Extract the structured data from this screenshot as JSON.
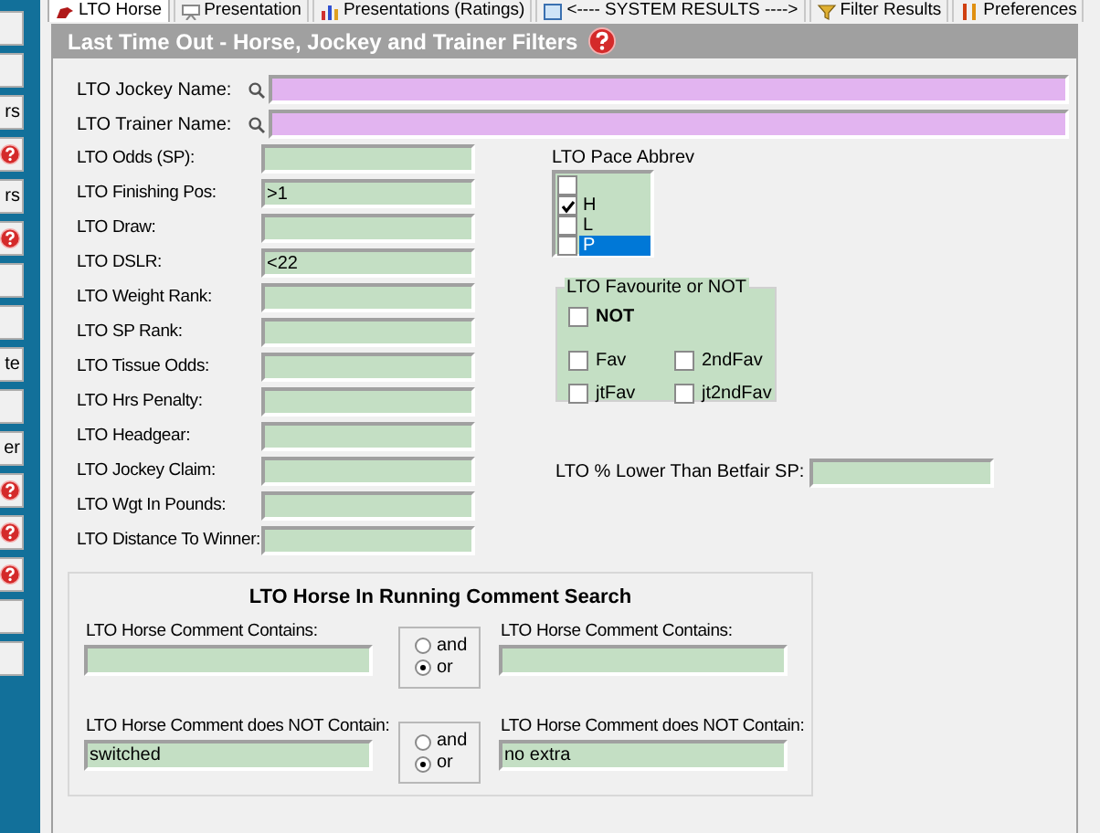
{
  "sidebar": {
    "items": [
      {
        "kind": "button"
      },
      {
        "kind": "button"
      },
      {
        "kind": "button",
        "label": "rs"
      },
      {
        "kind": "help"
      },
      {
        "kind": "button",
        "label": "rs"
      },
      {
        "kind": "help"
      },
      {
        "kind": "button"
      },
      {
        "kind": "button"
      },
      {
        "kind": "button",
        "label": "te"
      },
      {
        "kind": "button"
      },
      {
        "kind": "button",
        "label": "er"
      },
      {
        "kind": "help"
      },
      {
        "kind": "help"
      },
      {
        "kind": "help"
      },
      {
        "kind": "button"
      },
      {
        "kind": "button"
      }
    ]
  },
  "tabs": [
    {
      "label": "LTO Horse",
      "selected": true
    },
    {
      "label": "Presentation",
      "selected": false
    },
    {
      "label": "Presentations (Ratings)",
      "selected": false
    },
    {
      "label": "<---- SYSTEM RESULTS ---->",
      "selected": false
    },
    {
      "label": "Filter Results",
      "selected": false
    },
    {
      "label": "Preferences",
      "selected": false
    }
  ],
  "header": {
    "title": "Last Time Out - Horse, Jockey and Trainer Filters"
  },
  "search_fields": [
    {
      "label": "LTO Jockey Name:"
    },
    {
      "label": "LTO Trainer Name:"
    }
  ],
  "fields": [
    {
      "label": "LTO Odds (SP):"
    },
    {
      "label": "LTO Finishing Pos:",
      "value": ">1"
    },
    {
      "label": "LTO Draw:"
    },
    {
      "label": "LTO DSLR:",
      "value": "<22"
    },
    {
      "label": "LTO Weight Rank:"
    },
    {
      "label": "LTO SP Rank:"
    },
    {
      "label": "LTO Tissue Odds:"
    },
    {
      "label": "LTO Hrs Penalty:"
    },
    {
      "label": "LTO Headgear:"
    },
    {
      "label": "LTO Jockey Claim:"
    },
    {
      "label": "LTO Wgt In Pounds:"
    },
    {
      "label": "LTO Distance To Winner:"
    }
  ],
  "pace_abbrev": {
    "label": "LTO Pace Abbrev",
    "items": [
      {
        "checked": false,
        "selected": false
      },
      {
        "label": "H",
        "checked": true,
        "selected": false
      },
      {
        "label": "L",
        "checked": false,
        "selected": false
      },
      {
        "label": "P",
        "checked": false,
        "selected": true
      }
    ]
  },
  "favourite_group": {
    "title": "LTO Favourite or NOT",
    "not": {
      "label": "NOT",
      "checked": false
    },
    "options": [
      {
        "label": "Fav",
        "checked": false
      },
      {
        "label": "2ndFav",
        "checked": false
      },
      {
        "label": "jtFav",
        "checked": false
      },
      {
        "label": "jt2ndFav",
        "checked": false
      }
    ]
  },
  "betfair_field": {
    "label": "LTO % Lower Than Betfair SP:"
  },
  "comment_search": {
    "title": "LTO Horse In Running Comment Search",
    "rows": [
      {
        "left": {
          "label": "LTO Horse Comment Contains:"
        },
        "logic": [
          {
            "label": "and",
            "selected": false
          },
          {
            "label": "or",
            "selected": true
          }
        ],
        "right": {
          "label": "LTO Horse Comment Contains:"
        }
      },
      {
        "left": {
          "label": "LTO Horse Comment does NOT Contain:",
          "value": "switched"
        },
        "logic": [
          {
            "label": "and",
            "selected": false
          },
          {
            "label": "or",
            "selected": true
          }
        ],
        "right": {
          "label": "LTO Horse Comment does NOT Contain:",
          "value": "no extra"
        }
      }
    ]
  }
}
